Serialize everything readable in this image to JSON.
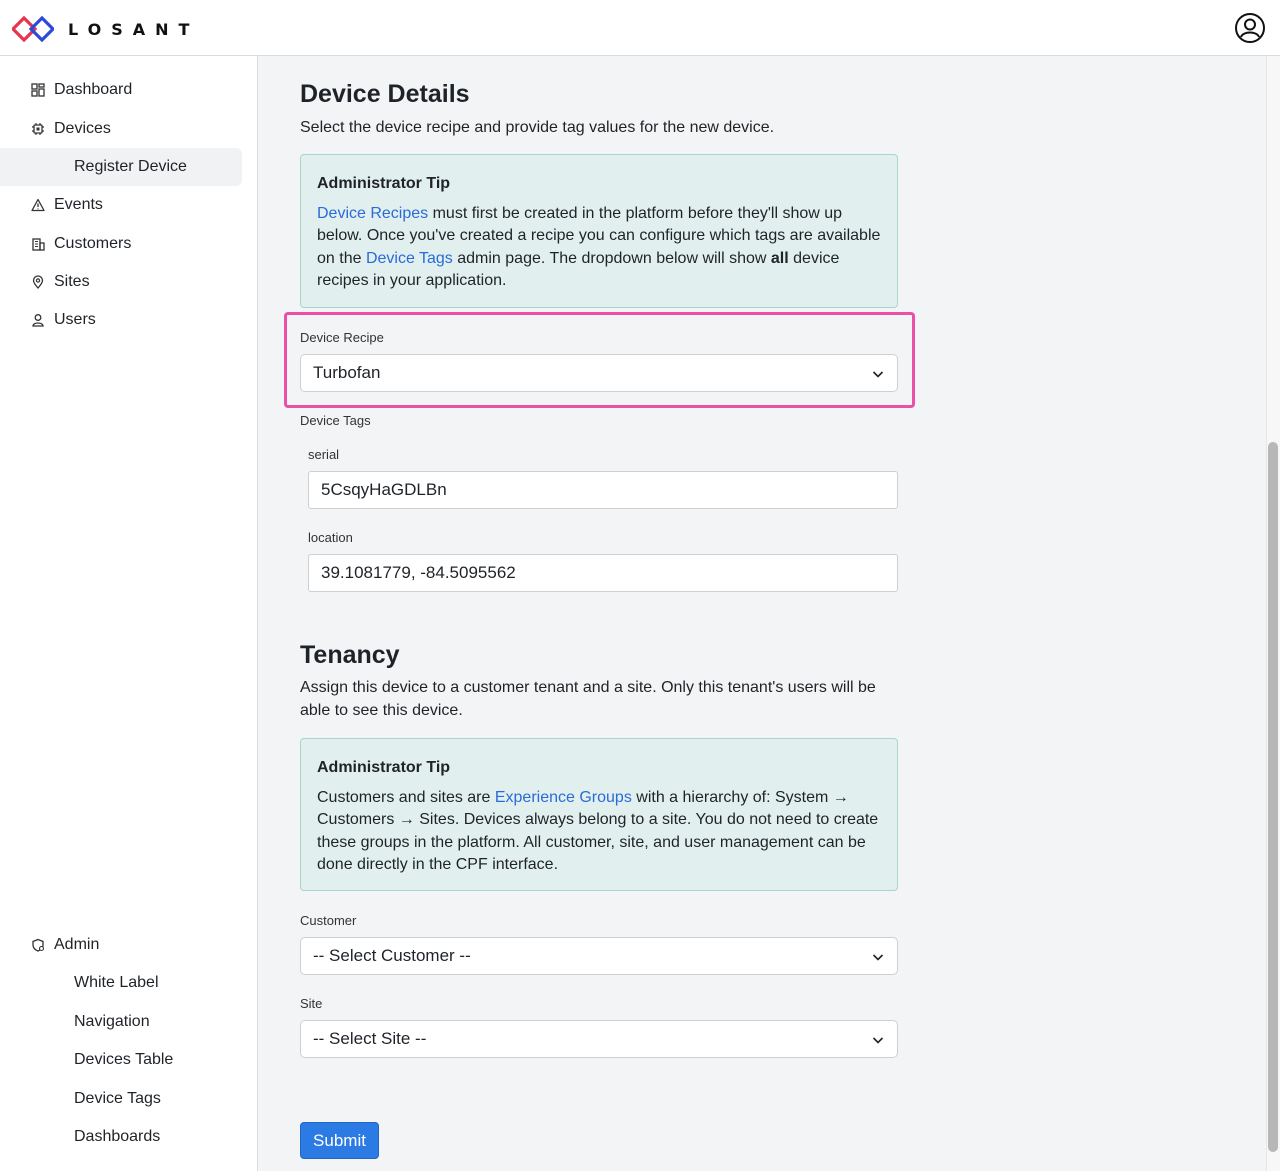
{
  "brand": {
    "logo_text": "LOSANT"
  },
  "sidebar": {
    "items": [
      {
        "label": "Dashboard",
        "icon": "dashboard-grid-icon"
      },
      {
        "label": "Devices",
        "icon": "chip-icon"
      },
      {
        "label": "Register Device"
      },
      {
        "label": "Events",
        "icon": "warning-triangle-icon"
      },
      {
        "label": "Customers",
        "icon": "building-icon"
      },
      {
        "label": "Sites",
        "icon": "map-pin-icon"
      },
      {
        "label": "Users",
        "icon": "user-icon"
      }
    ],
    "admin": {
      "label": "Admin",
      "icon": "admin-gear-icon",
      "items": [
        "White Label",
        "Navigation",
        "Devices Table",
        "Device Tags",
        "Dashboards"
      ]
    }
  },
  "device_details": {
    "title": "Device Details",
    "description": "Select the device recipe and provide tag values for the new device.",
    "tip": {
      "title": "Administrator Tip",
      "link1": "Device Recipes",
      "text1": " must first be created in the platform before they'll show up below. Once you've created a recipe you can configure which tags are available on the ",
      "link2": "Device Tags",
      "text2": " admin page. The dropdown below will show ",
      "bold": "all",
      "text3": " device recipes in your application."
    },
    "recipe_label": "Device Recipe",
    "recipe_value": "Turbofan",
    "tags_label": "Device Tags",
    "serial_label": "serial",
    "serial_value": "5CsqyHaGDLBn",
    "location_label": "location",
    "location_value": "39.1081779, -84.5095562"
  },
  "tenancy": {
    "title": "Tenancy",
    "description": "Assign this device to a customer tenant and a site. Only this tenant's users will be able to see this device.",
    "tip": {
      "title": "Administrator Tip",
      "text1": "Customers and sites are ",
      "link1": "Experience Groups",
      "text2": " with a hierarchy of: System → Customers → Sites. Devices always belong to a site. You do not need to create these groups in the platform. All customer, site, and user management can be done directly in the CPF interface."
    },
    "customer_label": "Customer",
    "customer_value": "-- Select Customer --",
    "site_label": "Site",
    "site_value": "-- Select Site --"
  },
  "submit_label": "Submit",
  "colors": {
    "accent": "#2c7be5",
    "link": "#2a6bd8",
    "tip_bg": "#e1f0ee",
    "highlight": "#ec4fa6"
  }
}
